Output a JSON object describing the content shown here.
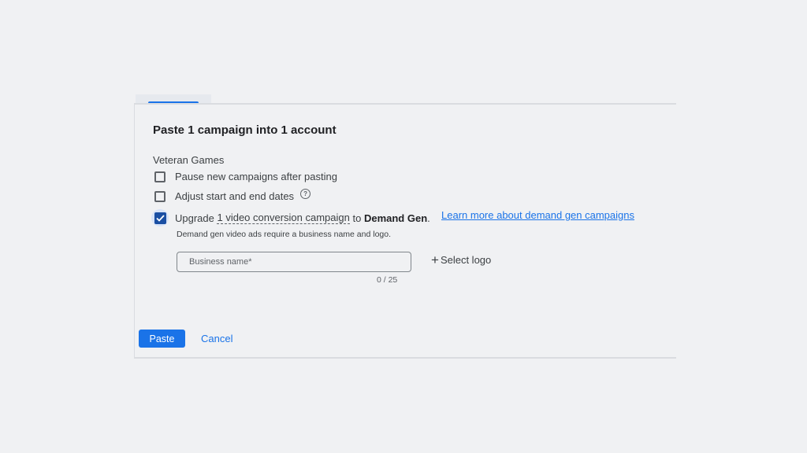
{
  "dialog": {
    "title": "Paste 1 campaign into 1 account",
    "account_name": "Veteran Games"
  },
  "options": {
    "pause": {
      "label": "Pause new campaigns after pasting",
      "checked": false
    },
    "adjust_dates": {
      "label": "Adjust start and end dates",
      "checked": false,
      "help_icon": "question-circle-icon"
    },
    "upgrade": {
      "checked": true,
      "prefix": "Upgrade ",
      "count_text": "1 video conversion campaign",
      "middle": " to ",
      "target": "Demand Gen",
      "suffix": ".",
      "learn_more": "Learn more about demand gen campaigns",
      "note": "Demand gen video ads require a business name and logo."
    }
  },
  "business": {
    "placeholder": "Business name*",
    "value": "",
    "counter": "0 / 25",
    "select_logo": "Select logo"
  },
  "actions": {
    "paste": "Paste",
    "cancel": "Cancel"
  },
  "colors": {
    "accent": "#1a73e8",
    "checkbox_checked": "#1a4fa3",
    "background": "#f0f1f3"
  }
}
